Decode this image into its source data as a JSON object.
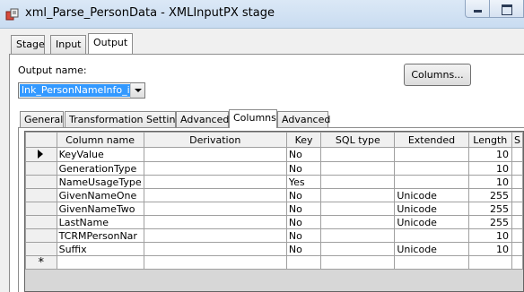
{
  "window": {
    "title": "xml_Parse_PersonData - XMLInputPX stage"
  },
  "outer_tabs": [
    "Stage",
    "Input",
    "Output"
  ],
  "output": {
    "name_label": "Output name:",
    "name_value": "lnk_PersonNameInfo_in",
    "columns_button": "Columns..."
  },
  "inner_tabs": [
    "General",
    "Transformation Settings",
    "Advanced",
    "Columns",
    "Advanced"
  ],
  "grid": {
    "headers": [
      "Column name",
      "Derivation",
      "Key",
      "SQL type",
      "Extended",
      "Length",
      "S"
    ],
    "rows": [
      {
        "name": "KeyValue",
        "derivation": "",
        "key": "No",
        "sql_type": "",
        "extended": "",
        "length": "10"
      },
      {
        "name": "GenerationType",
        "derivation": "",
        "key": "No",
        "sql_type": "",
        "extended": "",
        "length": "10"
      },
      {
        "name": "NameUsageType",
        "derivation": "",
        "key": "Yes",
        "sql_type": "",
        "extended": "",
        "length": "10"
      },
      {
        "name": "GivenNameOne",
        "derivation": "",
        "key": "No",
        "sql_type": "",
        "extended": "Unicode",
        "length": "255"
      },
      {
        "name": "GivenNameTwo",
        "derivation": "",
        "key": "No",
        "sql_type": "",
        "extended": "Unicode",
        "length": "255"
      },
      {
        "name": "LastName",
        "derivation": "",
        "key": "No",
        "sql_type": "",
        "extended": "Unicode",
        "length": "255"
      },
      {
        "name": "TCRMPersonNar",
        "derivation": "",
        "key": "No",
        "sql_type": "",
        "extended": "",
        "length": "10"
      },
      {
        "name": "Suffix",
        "derivation": "",
        "key": "No",
        "sql_type": "",
        "extended": "Unicode",
        "length": "10"
      }
    ],
    "new_row_marker": "*"
  },
  "colors": {
    "selection": "#3399ff",
    "titlebar": "#c9dcf1"
  },
  "icons": [
    "app-stage-icon",
    "minimize-icon",
    "maximize-icon",
    "current-row-arrow-icon"
  ]
}
